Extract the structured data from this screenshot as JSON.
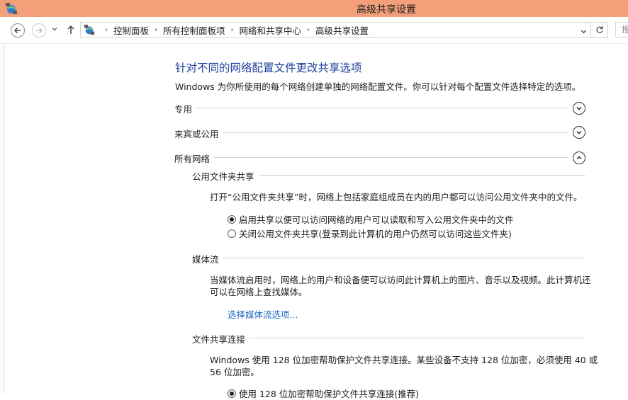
{
  "window": {
    "title": "高级共享设置"
  },
  "address": {
    "crumbs": [
      "控制面板",
      "所有控制面板项",
      "网络和共享中心",
      "高级共享设置"
    ],
    "search_placeholder": "搜"
  },
  "page": {
    "heading": "针对不同的网络配置文件更改共享选项",
    "intro": "Windows 为你所使用的每个网络创建单独的网络配置文件。你可以针对每个配置文件选择特定的选项。",
    "profiles": [
      {
        "label": "专用",
        "state": "collapsed"
      },
      {
        "label": "来宾或公用",
        "state": "collapsed"
      },
      {
        "label": "所有网络",
        "state": "expanded"
      }
    ],
    "public_folder": {
      "title": "公用文件夹共享",
      "desc": "打开“公用文件夹共享”时，网络上包括家庭组成员在内的用户都可以访问公用文件夹中的文件。",
      "options": [
        {
          "label": "启用共享以便可以访问网络的用户可以读取和写入公用文件夹中的文件",
          "checked": true
        },
        {
          "label": "关闭公用文件夹共享(登录到此计算机的用户仍然可以访问这些文件夹)",
          "checked": false
        }
      ]
    },
    "media": {
      "title": "媒体流",
      "desc_line1": "当媒体流启用时，网络上的用户和设备便可以访问此计算机上的图片、音乐以及视频。此计算机还",
      "desc_line2": "可以在网络上查找媒体。",
      "link": "选择媒体流选项..."
    },
    "file_sharing": {
      "title": "文件共享连接",
      "desc_line1": "Windows 使用 128 位加密帮助保护文件共享连接。某些设备不支持 128 位加密，必须使用 40 或",
      "desc_line2": "56 位加密。",
      "options": [
        {
          "label": "使用 128 位加密帮助保护文件共享连接(推荐)",
          "checked": true
        }
      ]
    }
  }
}
